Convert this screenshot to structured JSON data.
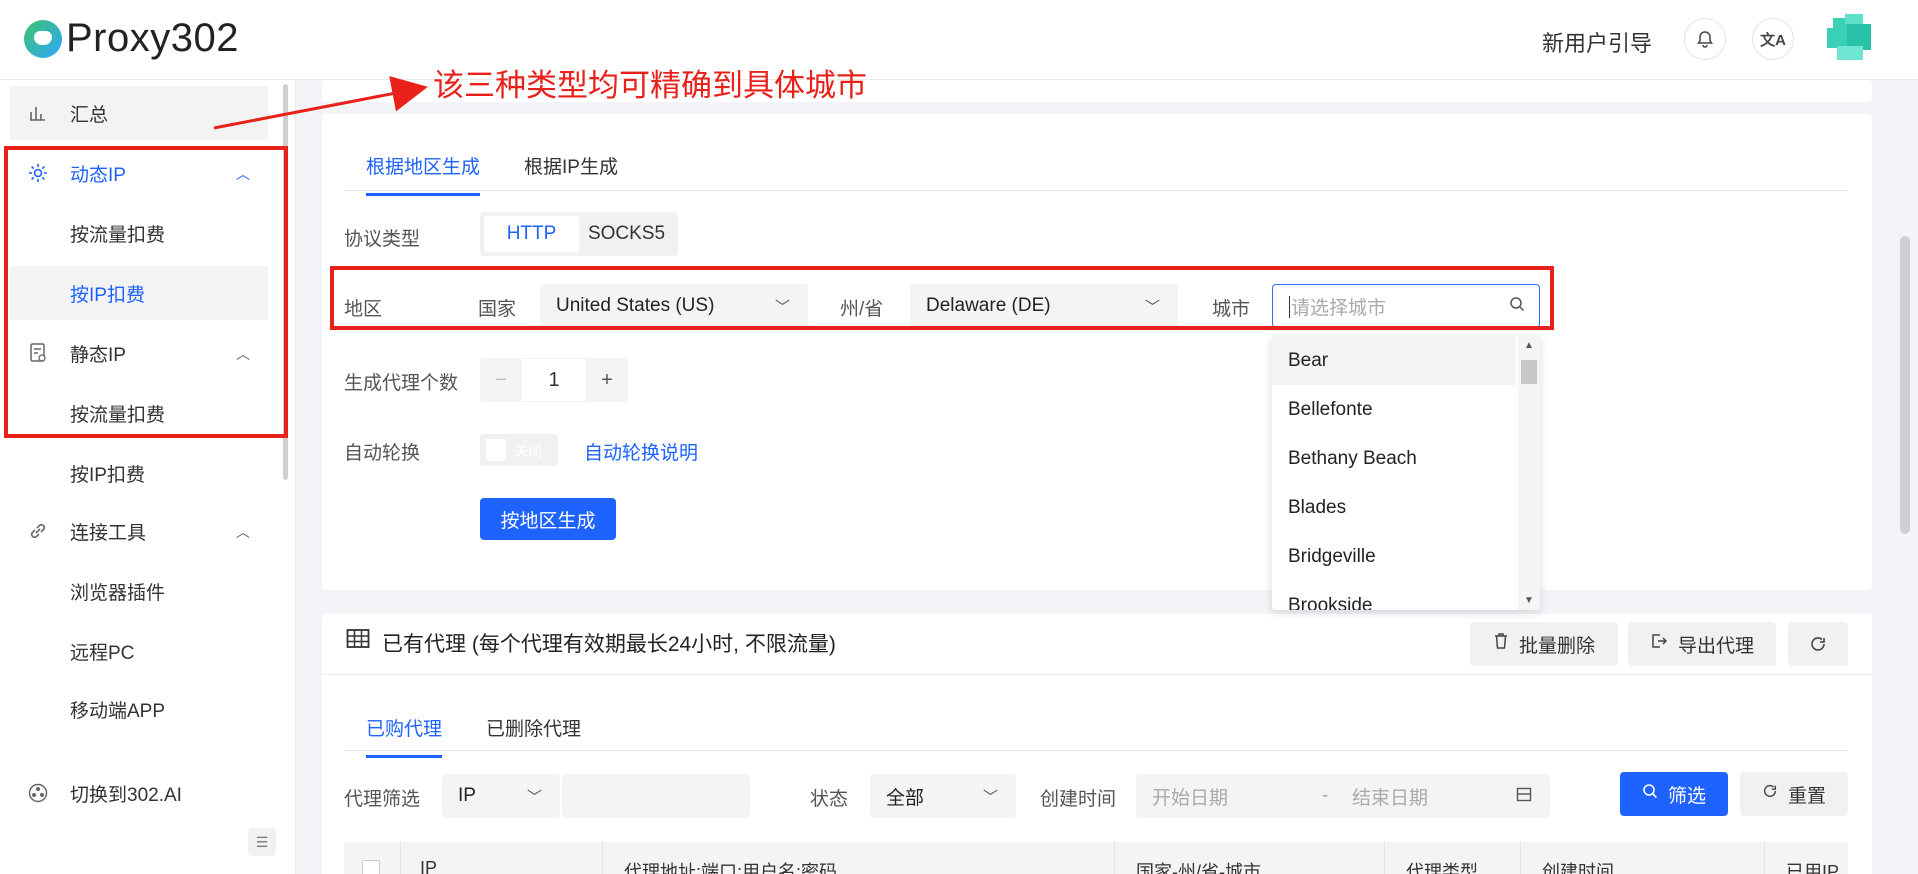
{
  "header": {
    "logo_text": "Proxy302",
    "new_user_guide": "新用户引导",
    "bell_icon": "bell-icon",
    "translate_icon": "translate-icon"
  },
  "sidebar": {
    "items": [
      {
        "label": "汇总",
        "icon": "bar-chart-icon"
      },
      {
        "label": "动态IP",
        "icon": "gear-icon"
      },
      {
        "label": "按流量扣费"
      },
      {
        "label": "按IP扣费"
      },
      {
        "label": "静态IP",
        "icon": "server-icon"
      },
      {
        "label": "按流量扣费"
      },
      {
        "label": "按IP扣费"
      },
      {
        "label": "连接工具",
        "icon": "link-icon"
      },
      {
        "label": "浏览器插件"
      },
      {
        "label": "远程PC"
      },
      {
        "label": "移动端APP"
      },
      {
        "label": "切换到302.AI",
        "icon": "switch-icon"
      }
    ]
  },
  "annotation": {
    "text": "该三种类型均可精确到具体城市",
    "color": "#e8221b"
  },
  "generator": {
    "tabs": [
      "根据地区生成",
      "根据IP生成"
    ],
    "protocol_label": "协议类型",
    "protocols": [
      "HTTP",
      "SOCKS5"
    ],
    "region_label": "地区",
    "country_label": "国家",
    "country_value": "United States (US)",
    "state_label": "州/省",
    "state_value": "Delaware (DE)",
    "city_label": "城市",
    "city_placeholder": "请选择城市",
    "count_label": "生成代理个数",
    "count_value": "1",
    "rotate_label": "自动轮换",
    "rotate_toggle_text": "关闭",
    "rotate_help_link": "自动轮换说明",
    "generate_button": "按地区生成"
  },
  "city_dropdown": {
    "options": [
      "Bear",
      "Bellefonte",
      "Bethany Beach",
      "Blades",
      "Bridgeville",
      "Brookside"
    ]
  },
  "proxies": {
    "title": "已有代理 (每个代理有效期最长24小时, 不限流量)",
    "batch_delete": "批量删除",
    "export": "导出代理",
    "tabs": [
      "已购代理",
      "已删除代理"
    ],
    "filter_label": "代理筛选",
    "filter_type": "IP",
    "status_label": "状态",
    "status_value": "全部",
    "created_label": "创建时间",
    "start_placeholder": "开始日期",
    "date_sep": "-",
    "end_placeholder": "结束日期",
    "filter_button": "筛选",
    "reset_button": "重置",
    "columns": [
      "IP",
      "代理地址:端口:用户名:密码",
      "国家-州/省-城市",
      "代理类型",
      "创建时间",
      "已用IP和"
    ]
  },
  "colors": {
    "accent": "#1e62ff",
    "annotation": "#e8221b"
  }
}
